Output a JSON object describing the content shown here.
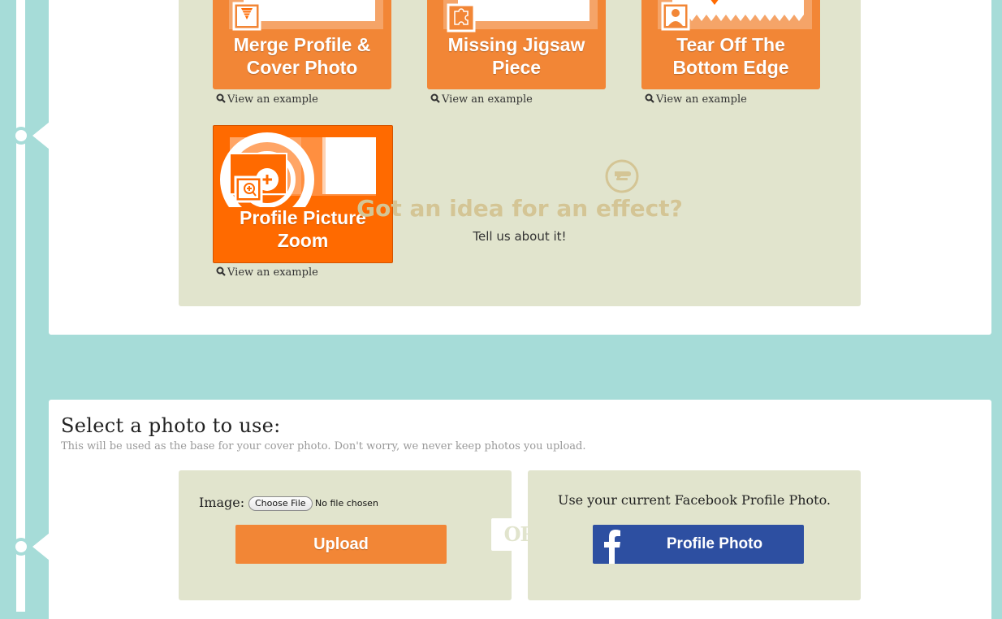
{
  "colors": {
    "background": "#a6dcd8",
    "tile_orange": "#f28636",
    "tile_selected": "#ff6a00",
    "box_beige": "#e1e4cd",
    "idea_gold": "#d4c595",
    "facebook_blue": "#2d4fa1"
  },
  "effects": {
    "tiles": [
      {
        "title_line1": "Merge Profile &",
        "title_line2": "Cover Photo",
        "icon": "merge-photo-icon",
        "link": "View an example",
        "selected": false
      },
      {
        "title_line1": "Missing Jigsaw",
        "title_line2": "Piece",
        "icon": "puzzle-piece-icon",
        "link": "View an example",
        "selected": false
      },
      {
        "title_line1": "Tear Off The",
        "title_line2": "Bottom Edge",
        "icon": "person-silhouette-icon",
        "link": "View an example",
        "selected": false
      },
      {
        "title_line1": "Profile Picture",
        "title_line2": "Zoom",
        "icon": "zoom-in-icon",
        "link": "View an example",
        "selected": true
      }
    ],
    "idea": {
      "icon": "speech-bubble-icon",
      "title": "Got an idea for an effect?",
      "link": "Tell us about it!"
    }
  },
  "select_photo": {
    "title": "Select a photo to use:",
    "subtitle": "This will be used as the base for your cover photo. Don't worry, we never keep photos you upload.",
    "upload": {
      "image_label": "Image:",
      "choose_file": "Choose File",
      "file_status": "No file chosen",
      "button": "Upload"
    },
    "or_label": "OR",
    "facebook": {
      "label": "Use your current Facebook Profile Photo.",
      "icon": "facebook-f-icon",
      "button": "Profile Photo"
    }
  }
}
